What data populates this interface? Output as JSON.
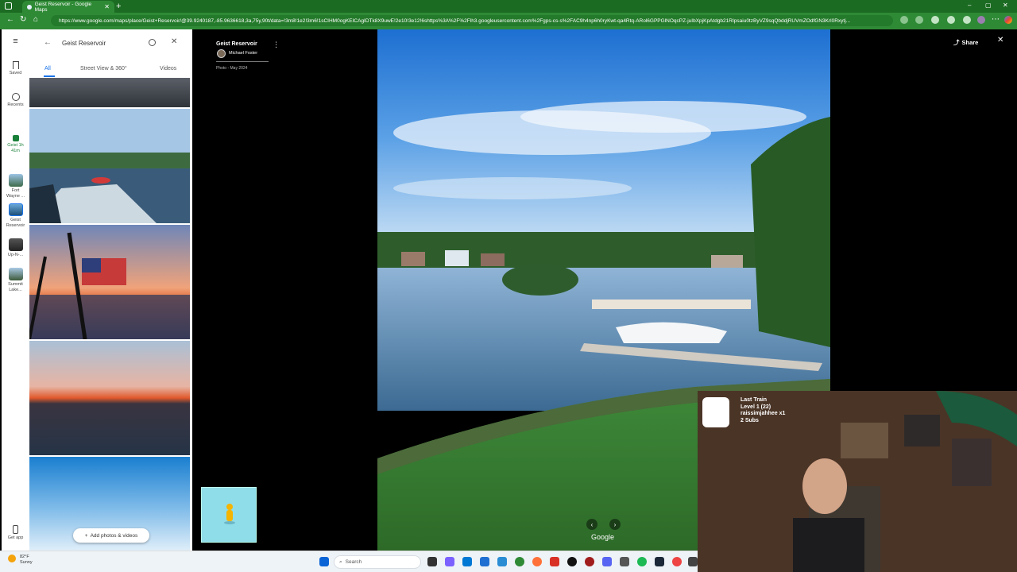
{
  "browser": {
    "tab_title": "Geist Reservoir - Google Maps",
    "url": "https://www.google.com/maps/place/Geist+Reservoir/@39.9240187,-85.9636618,3a,75y,90t/data=!3m8!1e2!3m6!1sCIHM0ogKEICAgIDTk8X9uwE!2e10!3e12!6shttps%3A%2F%2Flh3.googleusercontent.com%2Fgps-cs-s%2FAC9h4np6h0ryKwt-qa4Rtq-ARol6GPPGlNOqcPZ-juIbXpjKpAtdgb21RIpsaiu0tzByVZ9sqQbddjRUVmZOdfGN3Krl0Rxytj..."
  },
  "rail": {
    "items": [
      {
        "label": "Saved",
        "icon": "bookmark-icon"
      },
      {
        "label": "Recents",
        "icon": "history-icon"
      },
      {
        "label": "Geist 1h 41m",
        "icon": "train-icon"
      },
      {
        "label": "Fort Wayne ...",
        "icon": "place-thumbnail"
      },
      {
        "label": "Geist Reservoir",
        "icon": "place-thumbnail"
      },
      {
        "label": "Up-N-...",
        "icon": "place-thumbnail"
      },
      {
        "label": "Summit Lake...",
        "icon": "place-thumbnail"
      }
    ],
    "get_app": "Get app"
  },
  "panel": {
    "search_text": "Geist Reservoir",
    "tabs": [
      "All",
      "Street View & 360°",
      "Videos"
    ],
    "add_photos": "Add photos & videos"
  },
  "viewer": {
    "place_title": "Geist Reservoir",
    "author": "Michael Foster",
    "photo_date": "Photo - May 2024",
    "share": "Share",
    "watermark": "Google"
  },
  "overlay": {
    "lines": [
      "Last Train",
      "Level 1 (22)",
      "raissimjahhee x1",
      "2 Subs"
    ]
  },
  "taskbar": {
    "weather_temp": "82°F",
    "weather_desc": "Sunny",
    "search": "Search"
  },
  "colors": {
    "browser_green": "#2f8a36",
    "maps_blue": "#1a73e8"
  }
}
